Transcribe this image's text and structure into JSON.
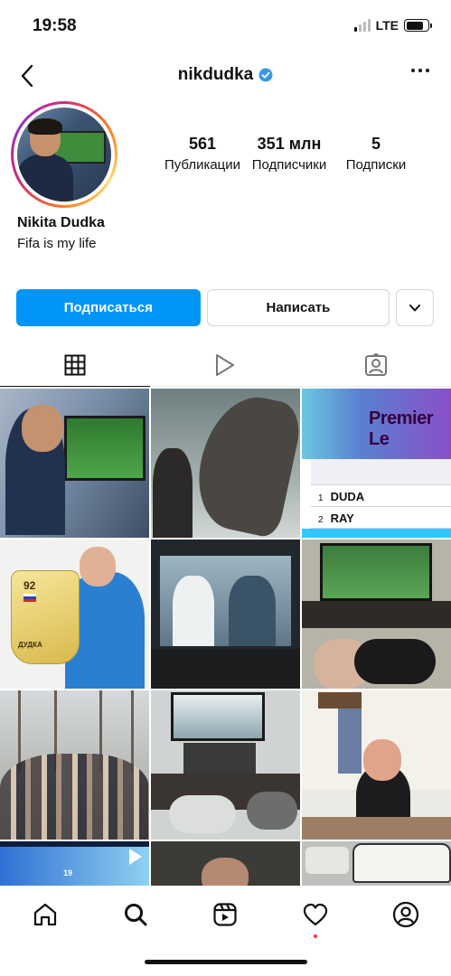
{
  "status_bar": {
    "time": "19:58",
    "network": "LTE",
    "icons": [
      "signal-icon",
      "battery-icon"
    ]
  },
  "header": {
    "username": "nikdudka",
    "verified": true,
    "icons": [
      "back-arrow-icon",
      "verified-badge-icon",
      "more-options-icon"
    ]
  },
  "profile": {
    "name": "Nikita Dudka",
    "bio": "Fifa is my life",
    "stats": [
      {
        "value": "561",
        "label": "Публикации"
      },
      {
        "value": "351 млн",
        "label": "Подписчики"
      },
      {
        "value": "5",
        "label": "Подписки"
      }
    ]
  },
  "actions": {
    "follow_label": "Подписаться",
    "message_label": "Написать",
    "dropdown_icon": "chevron-down-icon"
  },
  "tabs": [
    {
      "icon": "grid-icon",
      "active": true
    },
    {
      "icon": "reels-play-icon",
      "active": false
    },
    {
      "icon": "tagged-person-icon",
      "active": false
    }
  ],
  "grid": {
    "post_3": {
      "brand": "Premier Le",
      "rows": [
        {
          "num": "1",
          "name": "DUDA"
        },
        {
          "num": "2",
          "name": "RAY"
        }
      ]
    },
    "post_4": {
      "rating": "92",
      "card_name": "ДУДКА"
    },
    "post_10": {
      "number": "19"
    }
  },
  "bottom_nav": {
    "items": [
      "home-icon",
      "search-icon",
      "reels-icon",
      "activity-heart-icon",
      "profile-icon"
    ],
    "active": "search-icon",
    "notification_dot_on": "activity-heart-icon"
  },
  "colors": {
    "primary_button": "#0095f6",
    "notification_dot": "#ff3040",
    "verified": "#3897f0"
  }
}
